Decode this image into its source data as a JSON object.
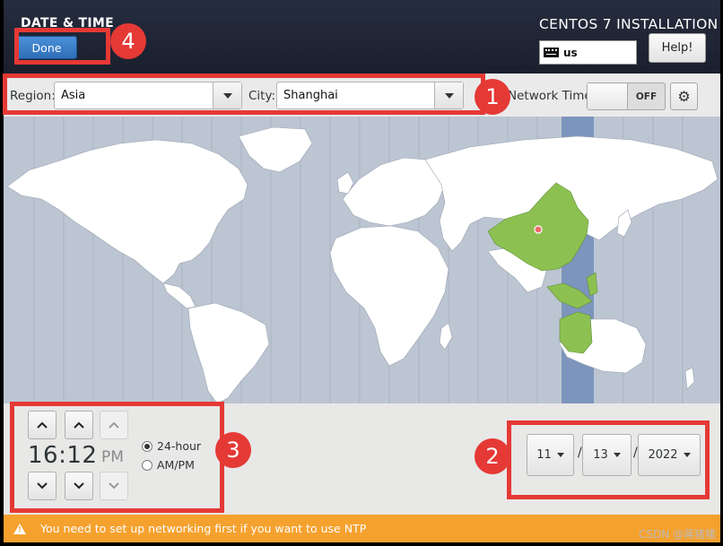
{
  "header": {
    "app_title": "DATE & TIME",
    "done_label": "Done",
    "installer_title": "CENTOS 7 INSTALLATION",
    "keyboard_layout": "us",
    "help_label": "Help!"
  },
  "toolbar": {
    "region_label": "Region:",
    "region_value": "Asia",
    "city_label": "City:",
    "city_value": "Shanghai",
    "network_time_label": "Network Time",
    "network_time_state": "OFF"
  },
  "map": {
    "ocean_color": "#bcc5d2",
    "land_color": "#ffffff",
    "selected_zone_color": "#8cc152",
    "timezone_band_color": "#7d95bc"
  },
  "time": {
    "hours": "16",
    "separator": ":",
    "minutes": "12",
    "ampm": "PM",
    "format_24h_label": "24-hour",
    "format_ampm_label": "AM/PM",
    "selected_format": "24-hour"
  },
  "date": {
    "month": "11",
    "day": "13",
    "year": "2022",
    "separator": "/"
  },
  "warning": {
    "message": "You need to set up networking first if you want to use NTP"
  },
  "annotations": {
    "n1": "1",
    "n2": "2",
    "n3": "3",
    "n4": "4"
  },
  "watermark": "CSDN @蒋猪猪"
}
